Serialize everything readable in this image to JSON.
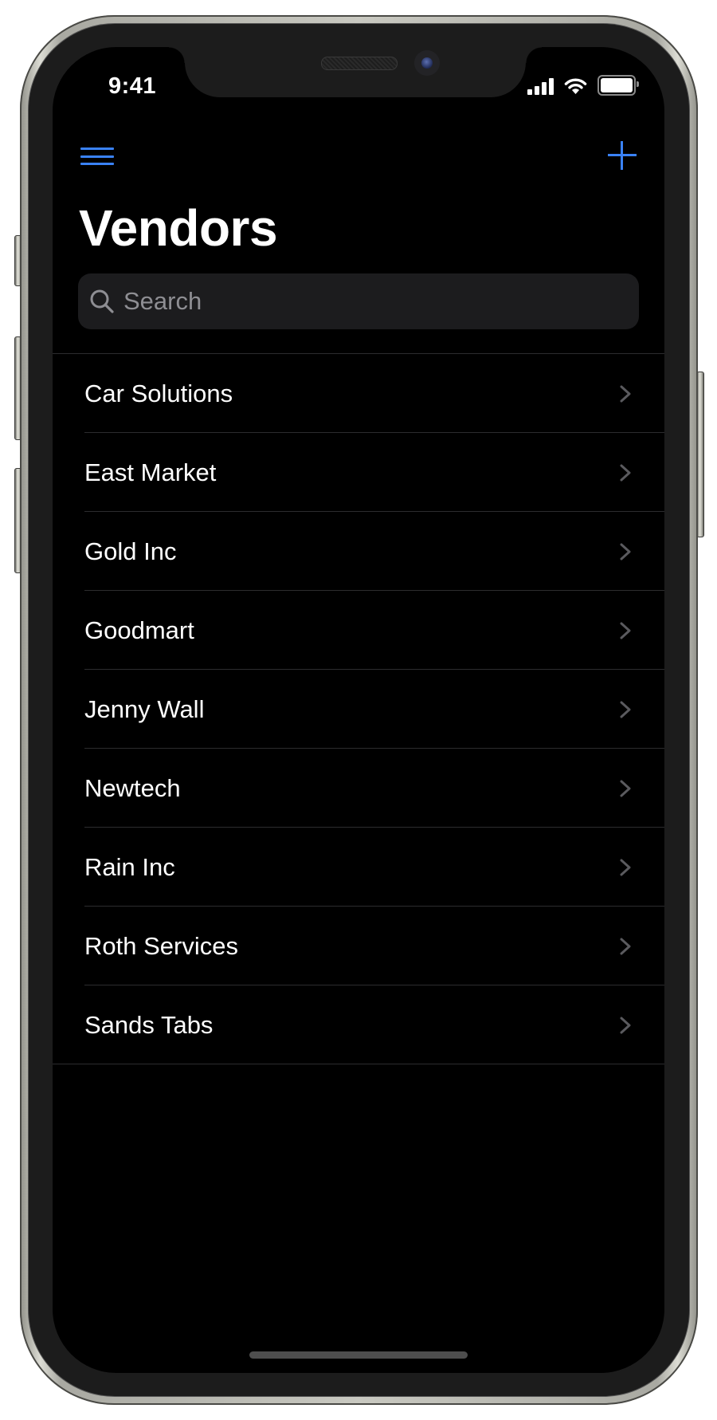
{
  "status_bar": {
    "time": "9:41",
    "icons": [
      "cellular-signal-icon",
      "wifi-icon",
      "battery-icon"
    ]
  },
  "nav": {
    "left_icon": "hamburger-menu-icon",
    "right_icon": "plus-icon",
    "accent_color": "#3a82f7"
  },
  "page": {
    "title": "Vendors"
  },
  "search": {
    "placeholder": "Search",
    "value": ""
  },
  "vendors": [
    {
      "name": "Car Solutions"
    },
    {
      "name": "East Market"
    },
    {
      "name": "Gold Inc"
    },
    {
      "name": "Goodmart"
    },
    {
      "name": "Jenny Wall"
    },
    {
      "name": "Newtech"
    },
    {
      "name": "Rain Inc"
    },
    {
      "name": "Roth Services"
    },
    {
      "name": "Sands Tabs"
    }
  ]
}
